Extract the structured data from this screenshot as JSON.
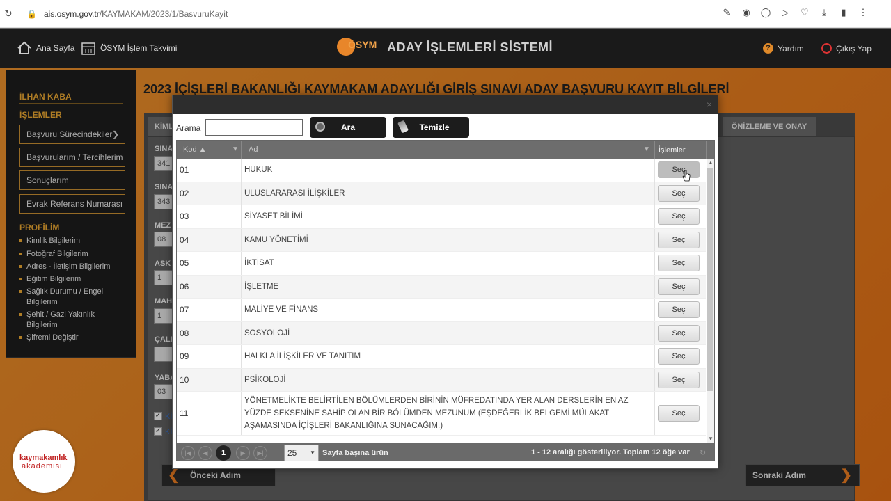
{
  "browser": {
    "url_domain": "ais.osym.gov.tr",
    "url_path": "/KAYMAKAM/2023/1/BasvuruKayit"
  },
  "header": {
    "home_label": "Ana Sayfa",
    "calendar_label": "ÖSYM İşlem Takvimi",
    "logo_text": "ÖSYM",
    "app_title": "ADAY İŞLEMLERİ SİSTEMİ",
    "help_label": "Yardım",
    "exit_label": "Çıkış Yap"
  },
  "sidebar": {
    "user_name": "İLHAN KABA",
    "section_operations": "İŞLEMLER",
    "operations": [
      "Başvuru Sürecindekiler",
      "Başvurularım / Tercihlerim",
      "Sonuçlarım",
      "Evrak Referans Numarası"
    ],
    "section_profile": "PROFİLİM",
    "profile_links": [
      "Kimlik Bilgilerim",
      "Fotoğraf Bilgilerim",
      "Adres - İletişim Bilgilerim",
      "Eğitim Bilgilerim",
      "Sağlık Durumu / Engel Bilgilerim",
      "Şehit / Gazi Yakınlık Bilgilerim",
      "Şifremi Değiştir"
    ]
  },
  "page": {
    "title": "2023 İÇİŞLERİ BAKANLIĞI KAYMAKAM ADAYLIĞI GİRİŞ SINAVI ADAY BAŞVURU KAYIT BİLGİLERİ",
    "tab_left": "KİMLİ",
    "tab_right": "ÖNİZLEME VE ONAY",
    "form_labels": [
      "SINA",
      "SINA",
      "MEZ",
      "ASK",
      "MAH",
      "ÇALI",
      "YABA"
    ],
    "form_values": [
      "341",
      "343",
      "08",
      "1",
      "1",
      "",
      "03"
    ],
    "check_labels": [
      "Kİ",
      "Kİ"
    ],
    "prev_button": "Önceki Adım",
    "next_button": "Sonraki Adım"
  },
  "modal": {
    "search_label": "Arama",
    "search_value": "",
    "search_button": "Ara",
    "clear_button": "Temizle",
    "columns": {
      "kod": "Kod",
      "ad": "Ad",
      "islemler": "İşlemler"
    },
    "select_label": "Seç",
    "rows": [
      {
        "kod": "01",
        "ad": "HUKUK"
      },
      {
        "kod": "02",
        "ad": "ULUSLARARASI İLİŞKİLER"
      },
      {
        "kod": "03",
        "ad": "SİYASET BİLİMİ"
      },
      {
        "kod": "04",
        "ad": "KAMU YÖNETİMİ"
      },
      {
        "kod": "05",
        "ad": "İKTİSAT"
      },
      {
        "kod": "06",
        "ad": "İŞLETME"
      },
      {
        "kod": "07",
        "ad": "MALİYE VE FİNANS"
      },
      {
        "kod": "08",
        "ad": "SOSYOLOJİ"
      },
      {
        "kod": "09",
        "ad": "HALKLA İLİŞKİLER VE TANITIM"
      },
      {
        "kod": "10",
        "ad": "PSİKOLOJİ"
      },
      {
        "kod": "11",
        "ad": "YÖNETMELİKTE BELİRTİLEN BÖLÜMLERDEN BİRİNİN MÜFREDATINDA YER ALAN DERSLERİN EN AZ YÜZDE SEKSENİNE SAHİP OLAN BİR BÖLÜMDEN MEZUNUM (EŞDEĞERLİK BELGEMİ MÜLAKAT AŞAMASINDA İÇİŞLERİ BAKANLIĞINA SUNACAĞIM.)"
      }
    ],
    "pager": {
      "current_page": "1",
      "page_size": "25",
      "page_size_label": "Sayfa başına ürün",
      "info": "1 - 12 aralığı gösteriliyor. Toplam 12 öğe var"
    }
  },
  "watermark": {
    "line1": "kaymakamlık",
    "line2": "akademisi"
  }
}
